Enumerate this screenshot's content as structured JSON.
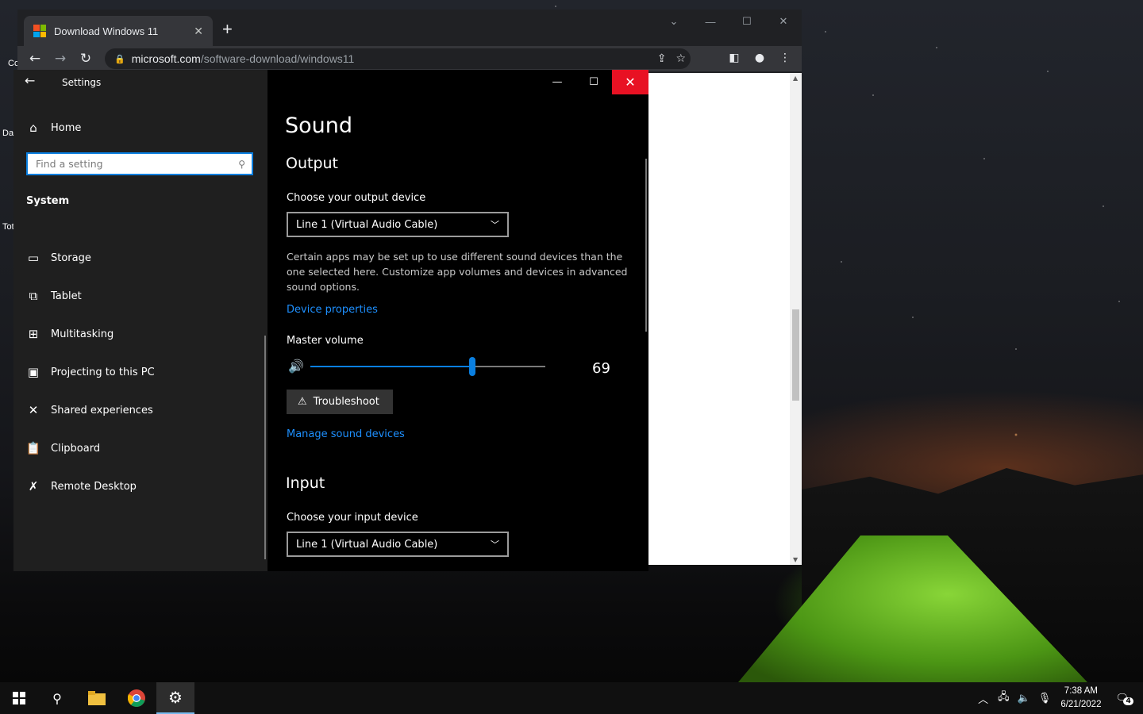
{
  "browser": {
    "tab_title": "Download Windows 11",
    "tab_close": "✕",
    "new_tab": "+",
    "url_host": "microsoft.com",
    "url_path": "/software-download/windows11"
  },
  "settings": {
    "window_title": "Settings",
    "home_label": "Home",
    "search_placeholder": "Find a setting",
    "section_label": "System",
    "nav_items": [
      {
        "label": "Storage"
      },
      {
        "label": "Tablet"
      },
      {
        "label": "Multitasking"
      },
      {
        "label": "Projecting to this PC"
      },
      {
        "label": "Shared experiences"
      },
      {
        "label": "Clipboard"
      },
      {
        "label": "Remote Desktop"
      }
    ],
    "page_title": "Sound",
    "output": {
      "heading": "Output",
      "choose_label": "Choose your output device",
      "selected_device": "Line 1 (Virtual Audio Cable)",
      "description": "Certain apps may be set up to use different sound devices than the one selected here. Customize app volumes and devices in advanced sound options.",
      "device_properties_link": "Device properties",
      "master_volume_label": "Master volume",
      "volume_value": "69",
      "volume_fraction": 0.69,
      "troubleshoot_label": "Troubleshoot",
      "manage_link": "Manage sound devices"
    },
    "input": {
      "heading": "Input",
      "choose_label": "Choose your input device",
      "selected_device": "Line 1 (Virtual Audio Cable)"
    }
  },
  "desktop": {
    "icon_labels": [
      "Co",
      "Da",
      "Tot"
    ]
  },
  "taskbar": {
    "time": "7:38 AM",
    "date": "6/21/2022",
    "notification_count": "4"
  },
  "colors": {
    "accent": "#0a7fe0",
    "close_red": "#e81123",
    "link": "#1e90ff"
  }
}
